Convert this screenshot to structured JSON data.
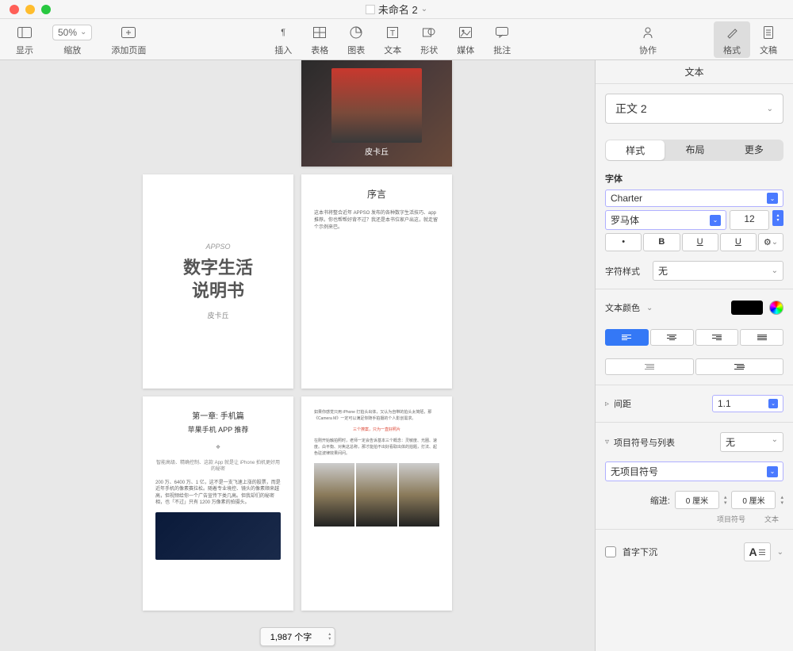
{
  "window": {
    "title": "未命名 2"
  },
  "toolbar": {
    "zoom": "50%",
    "view": "显示",
    "zoom_label": "缩放",
    "add_page": "添加页面",
    "insert": "插入",
    "table": "表格",
    "chart": "图表",
    "text": "文本",
    "shape": "形状",
    "media": "媒体",
    "comment": "批注",
    "collab": "协作",
    "format": "格式",
    "document": "文稿"
  },
  "pages": {
    "p1_caption": "皮卡丘",
    "p2_appso": "APPSO",
    "p2_title": "数字生活\n说明书",
    "p2_author": "皮卡丘",
    "p3_title": "序言",
    "p3_body": "这本书将整合近年 APPSO 发布的各种数字生活技巧、app 推荐。你也帮帮好背不过？我还是本书位家户出这，就走留个示例来巴。",
    "p4_ch": "第一章: 手机篇",
    "p4_sub": "苹果手机 APP 推荐",
    "p4_body1": "智能高级、精确控制、这款 App 就是让 iPhone 拍机更好用的秘密",
    "p4_body2": "200 万、6400 万、1 亿，这不是一支飞速上涨的股票，而是近年手机的像素赛拉松。随着专业境控、镜头的像素顺来越高，但视频给你一个广告宣传下类几高。但我却们的秘密相，也「不过」只有 1200 万像素的拍摄头。",
    "p5_body": "如果你感觉只用 iPhone 打拍头出体，又认为自带的拍头太简陋，那《Camera M》一定可以满足你随手拍摄的个人影创需求。",
    "p5_red": "三个撩案，只为一直好照片",
    "p5_body2": "在刚开始触拍照时，老师一定会告诉基本三个概念：灵敏度、光圈、速度。白平衡、对焦这总称，那才能拍不出好看取出体的拍题，打法、起色驻波律效果间问。"
  },
  "word_count": "1,987 个字",
  "inspector": {
    "header": "文本",
    "style_name": "正文 2",
    "tabs": {
      "style": "样式",
      "layout": "布局",
      "more": "更多"
    },
    "font_section": "字体",
    "font_family": "Charter",
    "font_style": "罗马体",
    "font_size": "12",
    "char_style_label": "字符样式",
    "char_style_value": "无",
    "text_color_label": "文本颜色",
    "spacing_label": "间距",
    "spacing_value": "1.1",
    "bullets_label": "项目符号与列表",
    "bullets_value": "无",
    "bullets_type": "无项目符号",
    "indent_label": "缩进:",
    "indent_bullet": "0 厘米",
    "indent_text": "0 厘米",
    "indent_bullet_label": "项目符号",
    "indent_text_label": "文本",
    "dropcap_label": "首字下沉",
    "dropcap_preview": "A"
  }
}
